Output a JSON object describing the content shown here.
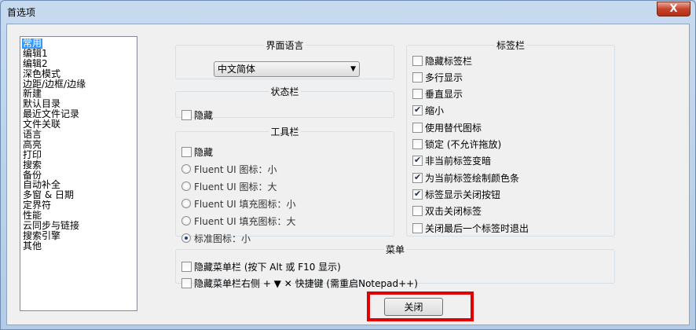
{
  "window": {
    "title": "首选项",
    "close_glyph": "X"
  },
  "categories": [
    "常用",
    "编辑1",
    "编辑2",
    "深色模式",
    "边距/边框/边缘",
    "新建",
    "默认目录",
    "最近文件记录",
    "文件关联",
    "语言",
    "高亮",
    "打印",
    "搜索",
    "备份",
    "自动补全",
    "多窗 & 日期",
    "定界符",
    "性能",
    "云同步与链接",
    "搜索引擎",
    "其他"
  ],
  "language_group": {
    "title": "界面语言",
    "selected": "中文简体",
    "arrow": "▼"
  },
  "status_group": {
    "title": "状态栏",
    "hide_label": "隐藏"
  },
  "toolbar_group": {
    "title": "工具栏",
    "hide_label": "隐藏",
    "options": [
      "Fluent UI 图标：小",
      "Fluent UI 图标：大",
      "Fluent UI 填充图标：小",
      "Fluent UI 填充图标：大",
      "标准图标：小"
    ],
    "selected_index": 4
  },
  "tabbar_group": {
    "title": "标签栏",
    "options": [
      {
        "label": "隐藏标签栏",
        "checked": false
      },
      {
        "label": "多行显示",
        "checked": false
      },
      {
        "label": "垂直显示",
        "checked": false
      },
      {
        "label": "缩小",
        "checked": true
      },
      {
        "label": "使用替代图标",
        "checked": false
      },
      {
        "label": "锁定 (不允许拖放)",
        "checked": false
      },
      {
        "label": "非当前标签变暗",
        "checked": true
      },
      {
        "label": "为当前标签绘制颜色条",
        "checked": true
      },
      {
        "label": "标签显示关闭按钮",
        "checked": true
      },
      {
        "label": "双击关闭标签",
        "checked": false
      },
      {
        "label": "关闭最后一个标签时退出",
        "checked": false
      }
    ]
  },
  "menu_group": {
    "title": "菜单",
    "options": [
      {
        "label": "隐藏菜单栏 (按下 Alt 或 F10 显示)",
        "checked": false
      },
      {
        "label": "隐藏菜单栏右侧 + ▼ ✕ 快捷键 (需重启Notepad++)",
        "checked": false
      }
    ]
  },
  "footer": {
    "close_label": "关闭"
  },
  "colors": {
    "selection": "#3399ff",
    "highlight_border": "#e00000"
  }
}
